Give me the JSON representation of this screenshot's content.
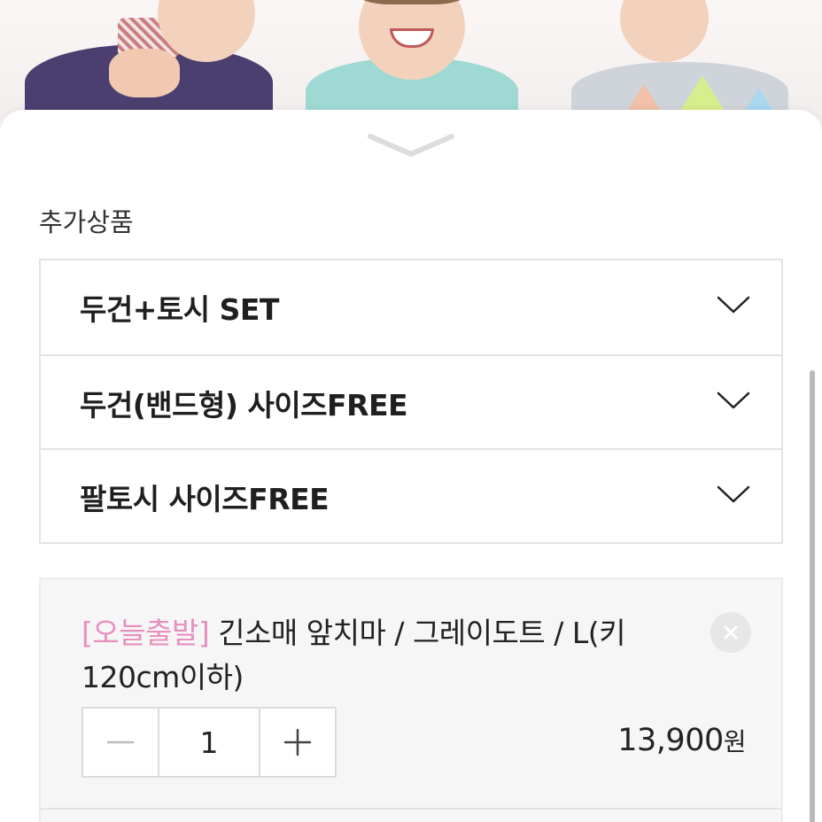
{
  "section_title": "추가상품",
  "options": [
    {
      "label": "두건+토시 SET"
    },
    {
      "label": "두건(밴드형) 사이즈FREE"
    },
    {
      "label": "팔토시 사이즈FREE"
    }
  ],
  "cart_item": {
    "tag": "[오늘출발]",
    "name": "긴소매 앞치마 / 그레이도트 / L(키 120cm이하)",
    "quantity": "1",
    "price": "13,900",
    "currency": "원"
  },
  "colors": {
    "tag": "#e98fbf",
    "border": "#e3e3e3",
    "cart_bg": "#f6f6f6"
  },
  "icons": {
    "handle": "chevron-down-icon",
    "option_dropdown": "chevron-down-icon",
    "remove": "close-icon",
    "decrease": "minus-icon",
    "increase": "plus-icon"
  }
}
